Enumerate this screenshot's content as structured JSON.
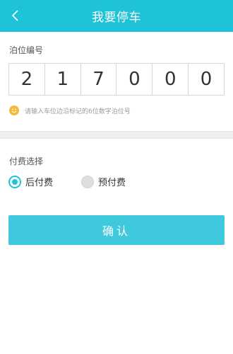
{
  "header": {
    "title": "我要停车",
    "back_icon": "chevron-left-icon"
  },
  "berth": {
    "label": "泊位编号",
    "digits": [
      "2",
      "1",
      "7",
      "0",
      "0",
      "0"
    ],
    "hint": "请输入车位边沿标记的6位数字泊位号",
    "hint_icon": "smiley-icon"
  },
  "payment": {
    "label": "付费选择",
    "options": [
      {
        "label": "后付费",
        "selected": true
      },
      {
        "label": "预付费",
        "selected": false
      }
    ]
  },
  "confirm": {
    "label": "确认"
  },
  "colors": {
    "accent": "#1fc3d8",
    "button": "#3ec9dd",
    "hint_icon": "#f5b93a"
  }
}
